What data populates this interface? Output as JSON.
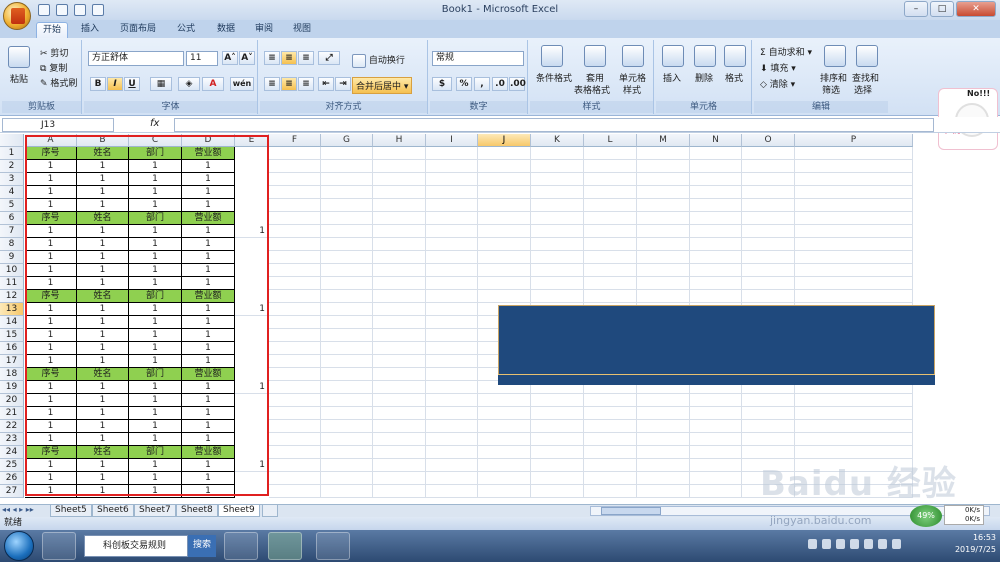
{
  "window": {
    "title": "Book1 - Microsoft Excel",
    "ctrl_min": "–",
    "ctrl_max": "□",
    "ctrl_close": "✕"
  },
  "tabs": [
    "开始",
    "插入",
    "页面布局",
    "公式",
    "数据",
    "审阅",
    "视图"
  ],
  "ribbon": {
    "clipboard": {
      "paste": "粘贴",
      "cut": "剪切",
      "copy": "复制",
      "format_painter": "格式刷",
      "label": "剪贴板"
    },
    "font": {
      "name": "方正舒体",
      "size": "11",
      "grow": "A˄",
      "shrink": "A˅",
      "bold": "B",
      "italic": "I",
      "underline": "U",
      "color_a": "A",
      "wen": "wén",
      "label": "字体"
    },
    "align": {
      "wrap": "自动换行",
      "merge": "合并后居中",
      "label": "对齐方式"
    },
    "number": {
      "format": "常规",
      "percent": "%",
      "comma": ",",
      "label": "数字"
    },
    "styles": {
      "conditional": "条件格式",
      "table1": "套用",
      "table2": "表格格式",
      "cell1": "单元格",
      "cell2": "样式",
      "label": "样式"
    },
    "cells": {
      "insert": "插入",
      "delete": "删除",
      "format": "格式",
      "label": "单元格"
    },
    "editing": {
      "autosum": "自动求和",
      "fill": "填充",
      "clear": "清除",
      "sort1": "排序和",
      "sort2": "筛选",
      "find1": "查找和",
      "find2": "选择",
      "label": "编辑"
    }
  },
  "formula": {
    "namebox": "J13",
    "fx": "fx",
    "value": ""
  },
  "sticker": {
    "no": "No!!!",
    "zh": "中 筒"
  },
  "columns": [
    "A",
    "B",
    "C",
    "D",
    "E",
    "F",
    "G",
    "H",
    "I",
    "J",
    "K",
    "L",
    "M",
    "N",
    "O",
    "P"
  ],
  "selected_col": "J",
  "selected_row": "13",
  "rows": [
    "1",
    "2",
    "3",
    "4",
    "5",
    "6",
    "7",
    "8",
    "9",
    "10",
    "11",
    "12",
    "13",
    "14",
    "15",
    "16",
    "17",
    "18",
    "19",
    "20",
    "21",
    "22",
    "23",
    "24",
    "25",
    "26",
    "27"
  ],
  "headers": [
    "序号",
    "姓名",
    "部门",
    "营业额"
  ],
  "cell_value": "1",
  "e_values": {
    "7": "1",
    "13": "1",
    "19": "1",
    "25": "1"
  },
  "sheets": [
    "Sheet5",
    "Sheet6",
    "Sheet7",
    "Sheet8",
    "Sheet9"
  ],
  "active_sheet": "Sheet9",
  "status": "就绪",
  "taskbar": {
    "search_placeholder": "科创板交易规则",
    "search_btn": "搜索",
    "time": "16:53",
    "date": "2019/7/25"
  },
  "net": {
    "percent": "49%",
    "up": "0K/s",
    "down": "0K/s"
  },
  "watermark": {
    "logo": "Baidu 经验",
    "url": "jingyan.baidu.com"
  }
}
